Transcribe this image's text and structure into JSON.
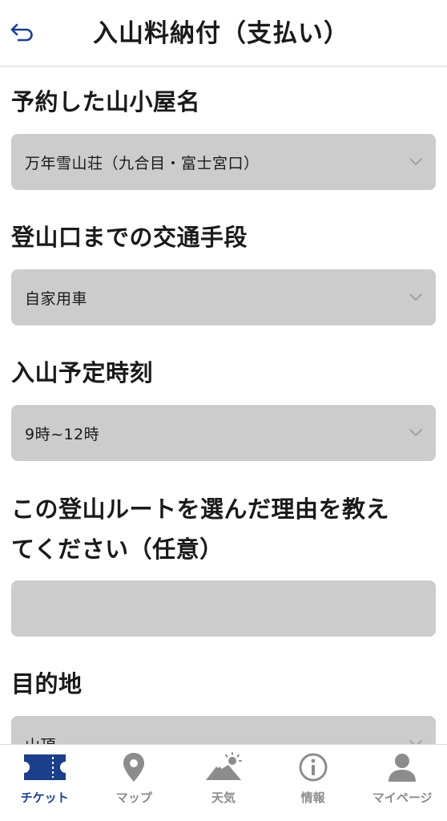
{
  "header": {
    "title": "入山料納付（支払い）",
    "back_icon": "back-arrow-icon"
  },
  "form": {
    "hut": {
      "label": "予約した山小屋名",
      "value": "万年雪山荘（九合目・富士宮口）"
    },
    "transport": {
      "label": "登山口までの交通手段",
      "value": "自家用車"
    },
    "entry_time": {
      "label": "入山予定時刻",
      "value": "9時~12時"
    },
    "route_reason": {
      "label_line1": "この登山ルートを選んだ理由を教え",
      "label_line2": "てください（任意）",
      "value": ""
    },
    "destination": {
      "label": "目的地",
      "value": "山頂"
    }
  },
  "tabbar": {
    "tabs": [
      {
        "label": "チケット",
        "icon": "ticket-icon",
        "active": true
      },
      {
        "label": "マップ",
        "icon": "map-pin-icon",
        "active": false
      },
      {
        "label": "天気",
        "icon": "weather-mountain-icon",
        "active": false
      },
      {
        "label": "情報",
        "icon": "info-icon",
        "active": false
      },
      {
        "label": "マイページ",
        "icon": "user-icon",
        "active": false
      }
    ]
  },
  "colors": {
    "accent": "#1c3f8c",
    "field_bg": "#cccccc",
    "inactive_tab": "#8c8c8c",
    "divider": "#d6d6d6"
  }
}
